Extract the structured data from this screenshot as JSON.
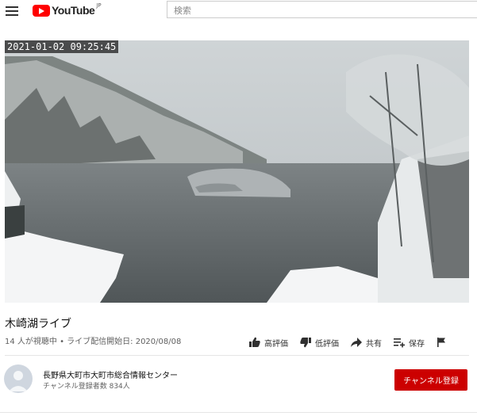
{
  "header": {
    "logo_text": "YouTube",
    "logo_region": "JP",
    "search_placeholder": "検索"
  },
  "video": {
    "timestamp_overlay": "2021-01-02 09:25:45",
    "title": "木崎湖ライブ",
    "meta": "14 人が視聴中 • ライブ配信開始日: 2020/08/08"
  },
  "actions": [
    {
      "label": "高評価",
      "icon": "thumbs-up-icon"
    },
    {
      "label": "低評価",
      "icon": "thumbs-down-icon"
    },
    {
      "label": "共有",
      "icon": "share-icon"
    },
    {
      "label": "保存",
      "icon": "save-to-playlist-icon"
    },
    {
      "label": "",
      "icon": "flag-icon"
    }
  ],
  "channel": {
    "name": "長野県大町市大町市総合情報センター",
    "subscribers": "チャンネル登録者数 834人",
    "subscribe_label": "チャンネル登録"
  },
  "colors": {
    "brand_red": "#ff0000",
    "subscribe_red": "#cc0000"
  }
}
